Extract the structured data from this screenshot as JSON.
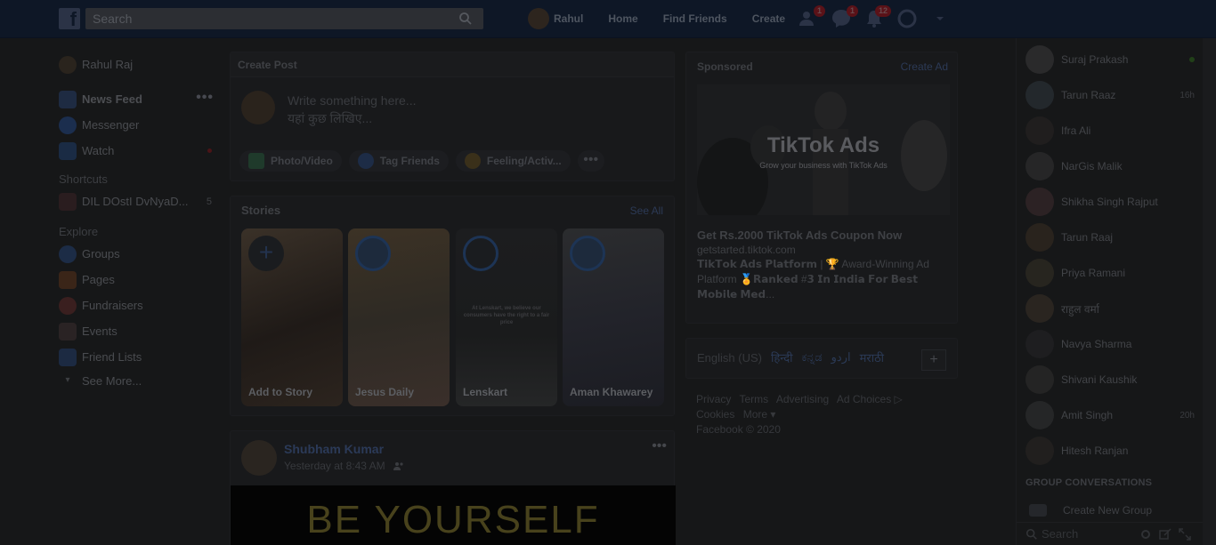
{
  "topbar": {
    "search_placeholder": "Search",
    "nav": [
      "Rahul",
      "Home",
      "Find Friends",
      "Create"
    ],
    "badges": {
      "friends": "1",
      "messages": "1",
      "notifications": "12"
    }
  },
  "leftnav": {
    "user": "Rahul Raj",
    "items": [
      "News Feed",
      "Messenger",
      "Watch"
    ],
    "more_dots": "•••",
    "shortcuts_title": "Shortcuts",
    "shortcut": {
      "label": "DIL DOstI DvNyaD...",
      "count": "5"
    },
    "explore_title": "Explore",
    "explore": [
      "Groups",
      "Pages",
      "Fundraisers",
      "Events",
      "Friend Lists"
    ],
    "see_more": "See More..."
  },
  "create_post": {
    "title": "Create Post",
    "placeholder_line1": "Write something here...",
    "placeholder_line2": "यहां कुछ लिखिए...",
    "actions": [
      "Photo/Video",
      "Tag Friends",
      "Feeling/Activ..."
    ],
    "more": "•••"
  },
  "stories": {
    "title": "Stories",
    "see_all": "See All",
    "items": [
      "Add to Story",
      "Jesus Daily",
      "Lenskart",
      "Aman Khawarey"
    ],
    "lenskart_text": "At Lenskart, we believe our consumers have the right to a fair price"
  },
  "post": {
    "author": "Shubham Kumar",
    "time": "Yesterday at 8:43 AM",
    "dots": "•••",
    "image_text": "BE YOURSELF"
  },
  "sponsored": {
    "title": "Sponsored",
    "create_ad": "Create Ad",
    "ad_title": "TikTok Ads",
    "ad_sub": "Grow your business with TikTok Ads",
    "headline": "Get Rs.2000 TikTok Ads Coupon Now",
    "url": "getstarted.tiktok.com",
    "desc": "𝗧𝗶𝗸𝗧𝗼𝗸 𝗔𝗱𝘀 𝗣𝗹𝗮𝘁𝗳𝗼𝗿𝗺 | 🏆 Award-Winning Ad Platform 🏅𝗥𝗮𝗻𝗸𝗲𝗱 #𝟯 𝗜𝗻 𝗜𝗻𝗱𝗶𝗮 𝗙𝗼𝗿 𝗕𝗲𝘀𝘁 𝗠𝗼𝗯𝗶𝗹𝗲 𝗠𝗲𝗱..."
  },
  "languages": [
    "English (US)",
    "हिन्दी",
    "ಕನ್ನಡ",
    "اردو",
    "मराठी"
  ],
  "lang_add": "+",
  "footer": {
    "links": [
      "Privacy",
      "Terms",
      "Advertising",
      "Ad Choices ▷",
      "Cookies",
      "More ▾"
    ],
    "copyright": "Facebook © 2020"
  },
  "chat": {
    "contacts": [
      {
        "name": "Suraj Prakash",
        "status": ""
      },
      {
        "name": "Tarun Raaz",
        "status": "16h"
      },
      {
        "name": "Ifra Ali",
        "status": ""
      },
      {
        "name": "NarGis Malik",
        "status": ""
      },
      {
        "name": "Shikha Singh Rajput",
        "status": ""
      },
      {
        "name": "Tarun Raaj",
        "status": ""
      },
      {
        "name": "Priya Ramani",
        "status": ""
      },
      {
        "name": "राहुल वर्मा",
        "status": ""
      },
      {
        "name": "Navya Sharma",
        "status": ""
      },
      {
        "name": "Shivani Kaushik",
        "status": ""
      },
      {
        "name": "Amit Singh",
        "status": "20h"
      },
      {
        "name": "Hitesh Ranjan",
        "status": ""
      }
    ],
    "group_title": "GROUP CONVERSATIONS",
    "create_group": "Create New Group",
    "search_placeholder": "Search"
  },
  "colors": {
    "brand": "#1d3455",
    "overlay_dim": "#161718"
  }
}
